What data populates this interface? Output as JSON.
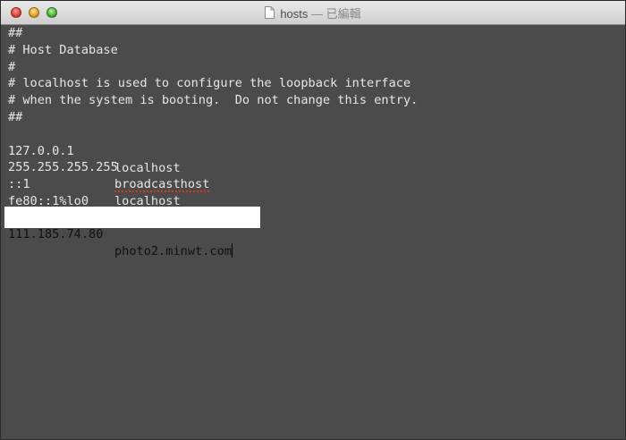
{
  "window": {
    "filename": "hosts",
    "status_sep": " — ",
    "status": "已編輯"
  },
  "hosts_file": {
    "comment_lines": [
      "##",
      "# Host Database",
      "#",
      "# localhost is used to configure the loopback interface",
      "# when the system is booting.  Do not change this entry.",
      "##"
    ],
    "entries": [
      {
        "ip": "127.0.0.1",
        "host": "localhost",
        "misspelled": false
      },
      {
        "ip": "255.255.255.255",
        "host": "broadcasthost",
        "misspelled": true
      },
      {
        "ip": "::1",
        "host": "localhost",
        "misspelled": false
      },
      {
        "ip": "fe80::1%lo0",
        "host": "localhost",
        "misspelled": false
      }
    ],
    "added_entry": {
      "ip": "111.185.74.80",
      "host": "photo2.minwt.com"
    }
  },
  "colors": {
    "editor_bg": "#4b4b4b",
    "text": "#e6e6e6",
    "highlight_bg": "#ffffff",
    "spellcheck_underline": "#d9362b"
  }
}
